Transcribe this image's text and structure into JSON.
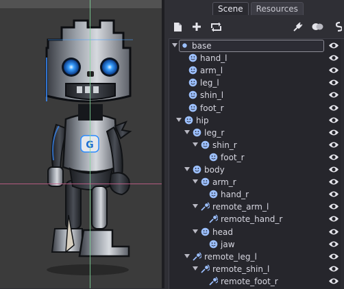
{
  "tabs": [
    {
      "label": "Scene",
      "active": true
    },
    {
      "label": "Resources",
      "active": false
    }
  ],
  "toolbar_icons": [
    "new-scene-icon",
    "add-node-icon",
    "instance-icon",
    "connect-icon",
    "groups-icon",
    "script-icon"
  ],
  "tree": {
    "nodes": [
      {
        "label": "base",
        "depth": 0,
        "expanded": true,
        "selected": true,
        "icon": "node-dot-icon"
      },
      {
        "label": "hand_l",
        "depth": 1,
        "expanded": null,
        "icon": "smiley-icon"
      },
      {
        "label": "arm_l",
        "depth": 1,
        "expanded": null,
        "icon": "smiley-icon"
      },
      {
        "label": "leg_l",
        "depth": 1,
        "expanded": null,
        "icon": "smiley-icon"
      },
      {
        "label": "shin_l",
        "depth": 1,
        "expanded": null,
        "icon": "smiley-icon"
      },
      {
        "label": "foot_r",
        "depth": 1,
        "expanded": null,
        "icon": "smiley-icon"
      },
      {
        "label": "hip",
        "depth": 0.5,
        "expanded": true,
        "icon": "smiley-icon"
      },
      {
        "label": "leg_r",
        "depth": 1.5,
        "expanded": true,
        "icon": "smiley-icon"
      },
      {
        "label": "shin_r",
        "depth": 2.5,
        "expanded": true,
        "icon": "smiley-icon"
      },
      {
        "label": "foot_r",
        "depth": 3.5,
        "expanded": null,
        "icon": "smiley-icon"
      },
      {
        "label": "body",
        "depth": 1.5,
        "expanded": true,
        "icon": "smiley-icon"
      },
      {
        "label": "arm_r",
        "depth": 2.5,
        "expanded": true,
        "icon": "smiley-icon"
      },
      {
        "label": "hand_r",
        "depth": 3.5,
        "expanded": null,
        "icon": "smiley-icon"
      },
      {
        "label": "remote_arm_l",
        "depth": 2.5,
        "expanded": true,
        "icon": "remote-transform-icon"
      },
      {
        "label": "remote_hand_r",
        "depth": 3.5,
        "expanded": null,
        "icon": "remote-transform-icon"
      },
      {
        "label": "head",
        "depth": 2.5,
        "expanded": true,
        "icon": "smiley-icon"
      },
      {
        "label": "jaw",
        "depth": 3.5,
        "expanded": null,
        "icon": "smiley-icon"
      },
      {
        "label": "remote_leg_l",
        "depth": 1.5,
        "expanded": true,
        "icon": "remote-transform-icon"
      },
      {
        "label": "remote_shin_l",
        "depth": 2.5,
        "expanded": true,
        "icon": "remote-transform-icon"
      },
      {
        "label": "remote_foot_r",
        "depth": 3.5,
        "expanded": null,
        "icon": "remote-transform-icon"
      }
    ]
  },
  "colors": {
    "accent_blue": "#2a8cff",
    "node_icon": "#8fb6ff",
    "guide_vertical": "#7fd89a",
    "guide_horizontal": "#c45f8a"
  }
}
